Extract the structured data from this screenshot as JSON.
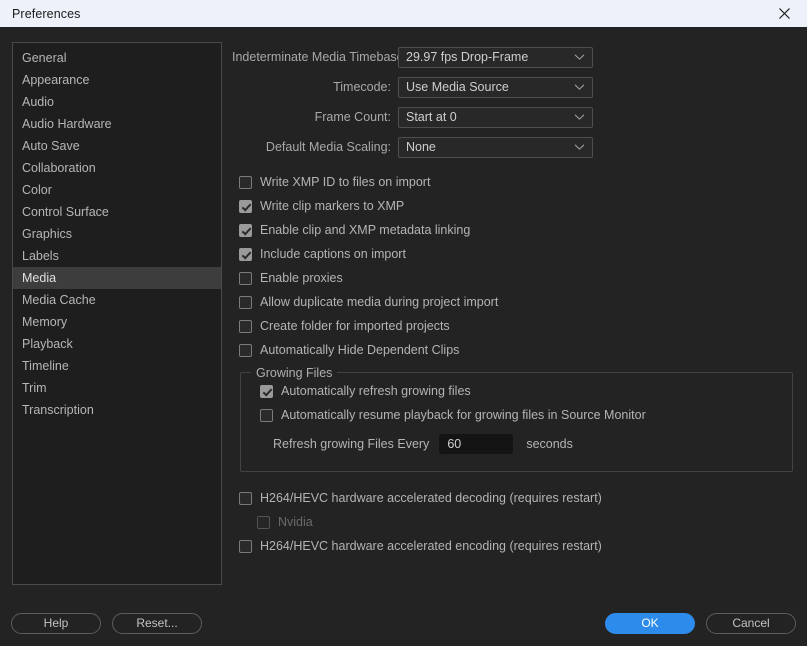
{
  "window": {
    "title": "Preferences",
    "close_icon": "close-icon"
  },
  "sidebar": {
    "items": [
      {
        "label": "General",
        "selected": false
      },
      {
        "label": "Appearance",
        "selected": false
      },
      {
        "label": "Audio",
        "selected": false
      },
      {
        "label": "Audio Hardware",
        "selected": false
      },
      {
        "label": "Auto Save",
        "selected": false
      },
      {
        "label": "Collaboration",
        "selected": false
      },
      {
        "label": "Color",
        "selected": false
      },
      {
        "label": "Control Surface",
        "selected": false
      },
      {
        "label": "Graphics",
        "selected": false
      },
      {
        "label": "Labels",
        "selected": false
      },
      {
        "label": "Media",
        "selected": true
      },
      {
        "label": "Media Cache",
        "selected": false
      },
      {
        "label": "Memory",
        "selected": false
      },
      {
        "label": "Playback",
        "selected": false
      },
      {
        "label": "Timeline",
        "selected": false
      },
      {
        "label": "Trim",
        "selected": false
      },
      {
        "label": "Transcription",
        "selected": false
      }
    ]
  },
  "main": {
    "selects": [
      {
        "label": "Indeterminate Media Timebase:",
        "value": "29.97 fps Drop-Frame"
      },
      {
        "label": "Timecode:",
        "value": "Use Media Source"
      },
      {
        "label": "Frame Count:",
        "value": "Start at 0"
      },
      {
        "label": "Default Media Scaling:",
        "value": "None"
      }
    ],
    "checkboxes": [
      {
        "label": "Write XMP ID to files on import",
        "checked": false
      },
      {
        "label": "Write clip markers to XMP",
        "checked": true
      },
      {
        "label": "Enable clip and XMP metadata linking",
        "checked": true
      },
      {
        "label": "Include captions on import",
        "checked": true
      },
      {
        "label": "Enable proxies",
        "checked": false
      },
      {
        "label": "Allow duplicate media during project import",
        "checked": false
      },
      {
        "label": "Create folder for imported projects",
        "checked": false
      },
      {
        "label": "Automatically Hide Dependent Clips",
        "checked": false
      }
    ],
    "growing_files": {
      "legend": "Growing Files",
      "checkboxes": [
        {
          "label": "Automatically refresh growing files",
          "checked": true
        },
        {
          "label": "Automatically resume playback for growing files in Source Monitor",
          "checked": false
        }
      ],
      "refresh_label": "Refresh growing Files Every",
      "refresh_value": "60",
      "refresh_placeholder": "60",
      "units": "seconds"
    },
    "hardware": [
      {
        "label": "H264/HEVC hardware accelerated decoding (requires restart)",
        "checked": false,
        "disabled": false,
        "indent": false
      },
      {
        "label": "Nvidia",
        "checked": false,
        "disabled": true,
        "indent": true
      },
      {
        "label": "H264/HEVC hardware accelerated encoding (requires restart)",
        "checked": false,
        "disabled": false,
        "indent": false
      }
    ]
  },
  "footer": {
    "help_label": "Help",
    "reset_label": "Reset...",
    "ok_label": "OK",
    "cancel_label": "Cancel"
  },
  "colors": {
    "titlebar_bg": "#edf1fa",
    "dialog_bg": "#232323",
    "sidebar_bg": "#1e1e1e",
    "selected_bg": "#3d3d3d",
    "accent": "#2d8ceb"
  }
}
